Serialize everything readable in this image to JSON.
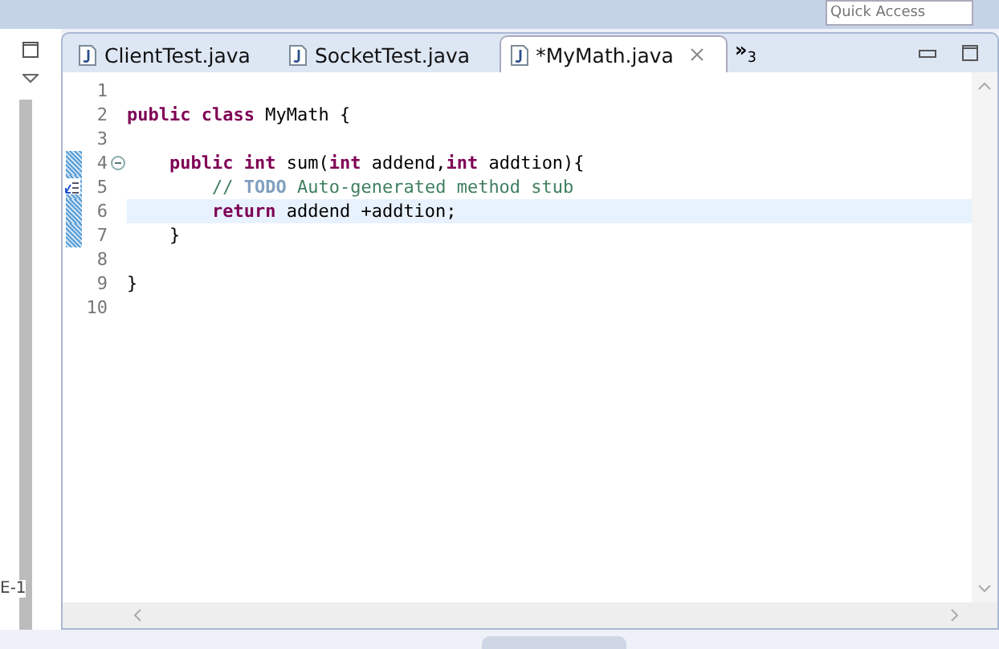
{
  "toolbar": {
    "quick_access": {
      "placeholder": "Quick Access"
    }
  },
  "left_panel": {
    "text": "E-1"
  },
  "editor": {
    "tabs": [
      {
        "label": "ClientTest.java",
        "selected": false
      },
      {
        "label": "SocketTest.java",
        "selected": false
      },
      {
        "label": "*MyMath.java",
        "selected": true
      }
    ],
    "overflow": {
      "symbol": "»",
      "count": "3"
    },
    "lines": [
      {
        "number": "1",
        "current": false,
        "changed": false,
        "fold": false,
        "task": false
      },
      {
        "number": "2",
        "current": false,
        "changed": false,
        "fold": false,
        "task": false,
        "segments": [
          {
            "kind": "keyword",
            "text": "public class"
          },
          {
            "kind": "plain",
            "text": " MyMath {"
          }
        ]
      },
      {
        "number": "3",
        "current": false,
        "changed": false,
        "fold": false,
        "task": false
      },
      {
        "number": "4",
        "current": false,
        "changed": true,
        "fold": true,
        "task": false,
        "segments": [
          {
            "kind": "keyword",
            "text": "    public int"
          },
          {
            "kind": "plain",
            "text": " sum("
          },
          {
            "kind": "keyword",
            "text": "int"
          },
          {
            "kind": "plain",
            "text": " addend,"
          },
          {
            "kind": "keyword",
            "text": "int"
          },
          {
            "kind": "plain",
            "text": " addtion){"
          }
        ]
      },
      {
        "number": "5",
        "current": false,
        "changed": true,
        "fold": false,
        "task": true,
        "segments": [
          {
            "kind": "comment",
            "text": "        // "
          },
          {
            "kind": "todo",
            "text": "TODO"
          },
          {
            "kind": "comment",
            "text": " Auto-generated method stub"
          }
        ]
      },
      {
        "number": "6",
        "current": true,
        "changed": true,
        "fold": false,
        "task": false,
        "segments": [
          {
            "kind": "keyword",
            "text": "        return"
          },
          {
            "kind": "plain",
            "text": " addend +addtion;"
          }
        ]
      },
      {
        "number": "7",
        "current": false,
        "changed": true,
        "fold": false,
        "task": false,
        "segments": [
          {
            "kind": "plain",
            "text": "    }"
          }
        ]
      },
      {
        "number": "8",
        "current": false,
        "changed": false,
        "fold": false,
        "task": false
      },
      {
        "number": "9",
        "current": false,
        "changed": false,
        "fold": false,
        "task": false,
        "segments": [
          {
            "kind": "plain",
            "text": "}"
          }
        ]
      },
      {
        "number": "10",
        "current": false,
        "changed": false,
        "fold": false,
        "task": false
      }
    ]
  }
}
